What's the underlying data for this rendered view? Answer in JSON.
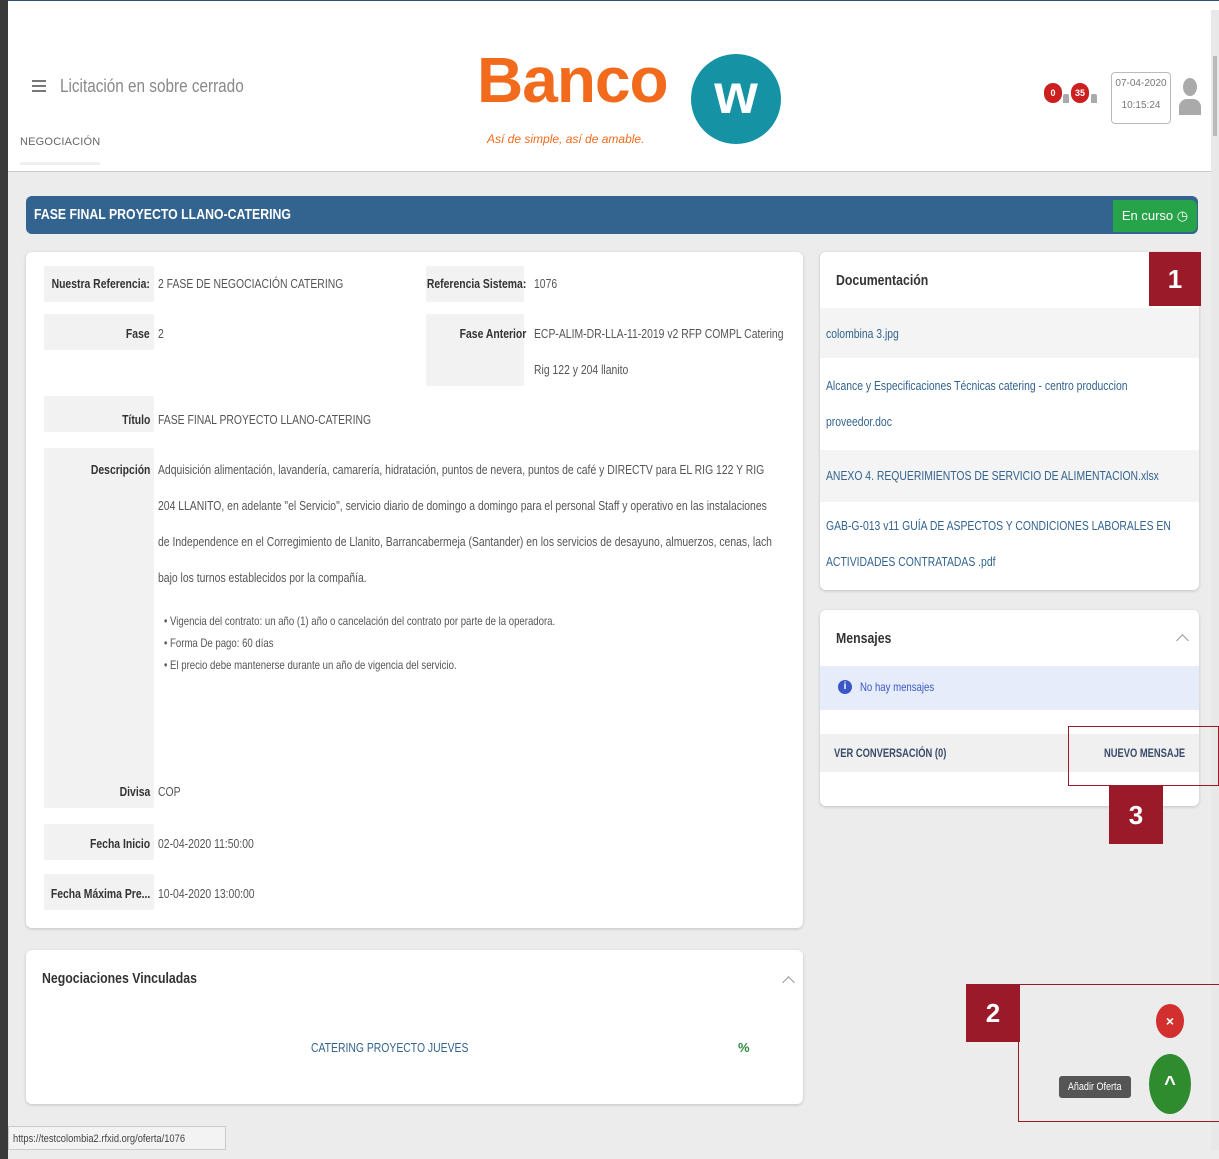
{
  "header": {
    "title": "Licitación en sobre cerrado",
    "tab": "NEGOCIACIÓN",
    "logo": {
      "name": "Banco",
      "mark": "w",
      "tagline": "Así de simple, así de amable."
    },
    "badges": [
      "0",
      "35"
    ],
    "date": "07-04-2020",
    "time": "10:15:24"
  },
  "title_bar": {
    "title": "FASE FINAL PROYECTO LLANO-CATERING",
    "status": "En curso"
  },
  "details": {
    "nuestra_referencia": {
      "label": "Nuestra Referencia:",
      "value": "2 FASE DE NEGOCIACIÓN CATERING"
    },
    "referencia_sistema": {
      "label": "Referencia Sistema:",
      "value": "1076"
    },
    "fase": {
      "label": "Fase",
      "value": "2"
    },
    "fase_anterior": {
      "label": "Fase Anterior",
      "value_line1": "ECP-ALIM-DR-LLA-11-2019 v2 RFP COMPL Catering",
      "value_line2": "Rig 122 y 204 llanito"
    },
    "titulo": {
      "label": "Título",
      "value": "FASE FINAL PROYECTO LLANO-CATERING"
    },
    "descripcion": {
      "label": "Descripción",
      "lines": [
        "Adquisición alimentación, lavandería, camarería, hidratación, puntos de nevera, puntos de café y DIRECTV para EL RIG 122 Y RIG",
        "204 LLANITO, en adelante \"el Servicio\", servicio diario de domingo a domingo para el personal Staff y operativo en las instalaciones",
        "de Independence en el Corregimiento de Llanito, Barrancabermeja (Santander) en los servicios de desayuno, almuerzos, cenas, lach",
        "bajo los turnos establecidos por la compañía."
      ],
      "bullets": [
        "Vigencia del contrato: un año (1) año o cancelación del contrato por parte de la operadora.",
        "Forma De pago: 60 días",
        "El precio debe mantenerse durante un año de vigencia del servicio."
      ]
    },
    "divisa": {
      "label": "Divisa",
      "value": "COP"
    },
    "fecha_inicio": {
      "label": "Fecha Inicio",
      "value": "02-04-2020 11:50:00"
    },
    "fecha_maxima": {
      "label": "Fecha Máxima Pre...",
      "value": "10-04-2020 13:00:00"
    }
  },
  "documentacion": {
    "title": "Documentación",
    "items": [
      "colombina 3.jpg",
      "Alcance y Especificaciones Técnicas catering - centro produccion",
      "proveedor.doc",
      "ANEXO 4. REQUERIMIENTOS DE SERVICIO DE ALIMENTACION.xlsx",
      "GAB-G-013 v11 GUÍA DE ASPECTOS Y CONDICIONES LABORALES EN",
      "ACTIVIDADES CONTRATADAS .pdf"
    ]
  },
  "mensajes": {
    "title": "Mensajes",
    "empty": "No hay mensajes",
    "ver": "VER CONVERSACIÓN (0)",
    "nuevo": "NUEVO MENSAJE"
  },
  "negociaciones": {
    "title": "Negociaciones Vinculadas",
    "link": "CATERING PROYECTO JUEVES"
  },
  "fab": {
    "tooltip": "Añadir Oferta",
    "close": "×",
    "open": "^"
  },
  "annotations": [
    "1",
    "2",
    "3"
  ],
  "status_url": "https://testcolombia2.rfxid.org/oferta/1076",
  "colors": {
    "header_bar": "#33638f",
    "status_green": "#27a34a",
    "annotation": "#9a1a2a",
    "brand_orange": "#f26a1b",
    "brand_teal": "#1593a5"
  }
}
